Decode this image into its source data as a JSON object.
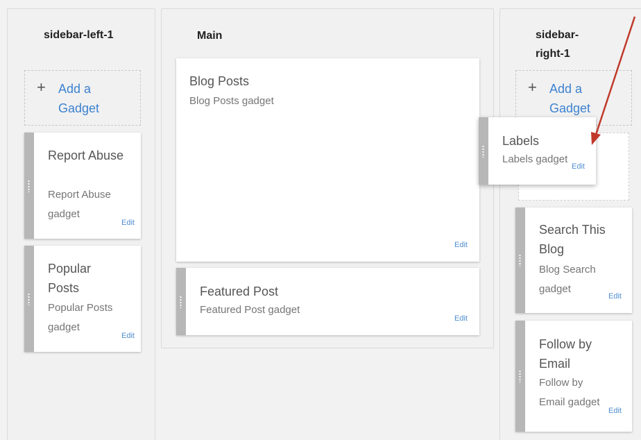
{
  "columns": {
    "left": {
      "title": "sidebar-left-1"
    },
    "main": {
      "title": "Main"
    },
    "right": {
      "title": "sidebar-right-1"
    }
  },
  "add_gadget_label": "Add a Gadget",
  "add_icon": "plus-icon",
  "drag_handle_icon": "drag-handle-icon",
  "edit_label": "Edit",
  "gadgets": {
    "report_abuse": {
      "title": "Report Abuse",
      "subtitle": "Report Abuse gadget"
    },
    "popular_posts": {
      "title": "Popular Posts",
      "subtitle": "Popular Posts gadget"
    },
    "blog_posts": {
      "title": "Blog Posts",
      "subtitle": "Blog Posts gadget"
    },
    "featured_post": {
      "title": "Featured Post",
      "subtitle": "Featured Post gadget"
    },
    "labels": {
      "title": "Labels",
      "subtitle": "Labels gadget"
    },
    "search": {
      "title": "Search This Blog",
      "subtitle": "Blog Search gadget"
    },
    "follow": {
      "title": "Follow by Email",
      "subtitle": "Follow by Email gadget"
    }
  },
  "annotation_arrow_color": "#c0392b",
  "accent_link_color": "#3d82d0"
}
